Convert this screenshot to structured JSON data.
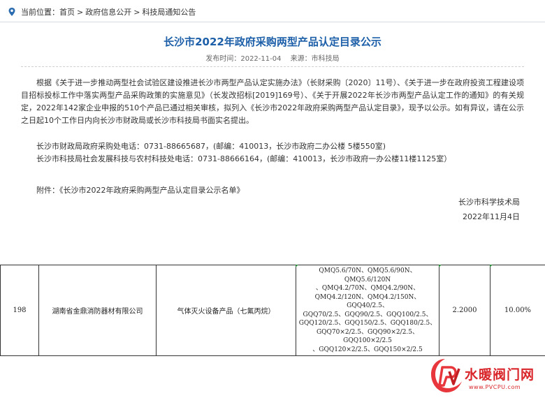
{
  "breadcrumb": {
    "prefix": "当前位置：",
    "items": [
      "首页",
      "政府信息公开",
      "科技局通知公告"
    ],
    "separator": ">"
  },
  "article": {
    "title": "长沙市2022年政府采购两型产品认定目录公示",
    "publish_time": "发布时间：2022-11-04",
    "source": "来源：市科技局",
    "body": "根据《关于进一步推动两型社会试验区建设推进长沙市两型产品认定实施办法》（长财采购〔2020〕11号）、《关于进一步在政府投资工程建设项目招标投标工作中落实两型产品采购政策的实施意见》（长发改招标[2019]169号）、《关于开展2022年长沙市两型产品认定工作的通知》的有关规定，2022年142家企业申报的510个产品已通过相关审核，拟列入《长沙市2022年政府采购两型产品认定目录》，现予以公示。如有异议，请在公示之日起10个工作日内向长沙市财政局或长沙市科技局书面实名提出。",
    "contact1": "长沙市财政局政府采购处电话：0731-88665687，(邮编：410013，长沙市政府二办公楼 5楼550室)",
    "contact2": "长沙市科技局社会发展科技与农村科技处电话：0731-88666164，(邮编：410013，长沙市政府一办公楼11楼1125室）",
    "attachment": "附件：《长沙市2022年政府采购两型产品认定目录公示名单》",
    "signature": "长沙市科学技术局",
    "date": "2022年11月4日"
  },
  "table": {
    "rows": [
      {
        "index": "198",
        "company": "湖南省金鼎消防器材有限公司",
        "product": "气体灭火设备产品（七氟丙烷）",
        "models": [
          "QMQ5.6/70N、QMQ5.6/90N、QMQ5.6/120N",
          "、QMQ4.2/70N、QMQ4.2/90N、",
          "QMQ4.2/120N、QMQ4.2/150N、GQQ40/2.5、",
          "GQQ70/2.5、GQQ90/2.5、GQQ100/2.5、",
          "GQQ120/2.5、GQQ150/2.5、GQQ180/2.5、",
          "GQQ70×2/2.5、GQQ90×2/2.5、GQQ100×2/2.5",
          "、GQQ120×2/2.5、GQQ150×2/2.5"
        ],
        "value": "2.2000",
        "rate": "10.00%"
      }
    ]
  },
  "watermark": {
    "text": "水暖阀门网",
    "url": "www.PVCPU.com"
  },
  "colors": {
    "title": "#1c5fa8",
    "pin": "#2b6cb0",
    "watermark": "#d9262b"
  },
  "icons": {
    "breadcrumb": "location-pin-icon",
    "watermark": "pv-logo-icon"
  }
}
